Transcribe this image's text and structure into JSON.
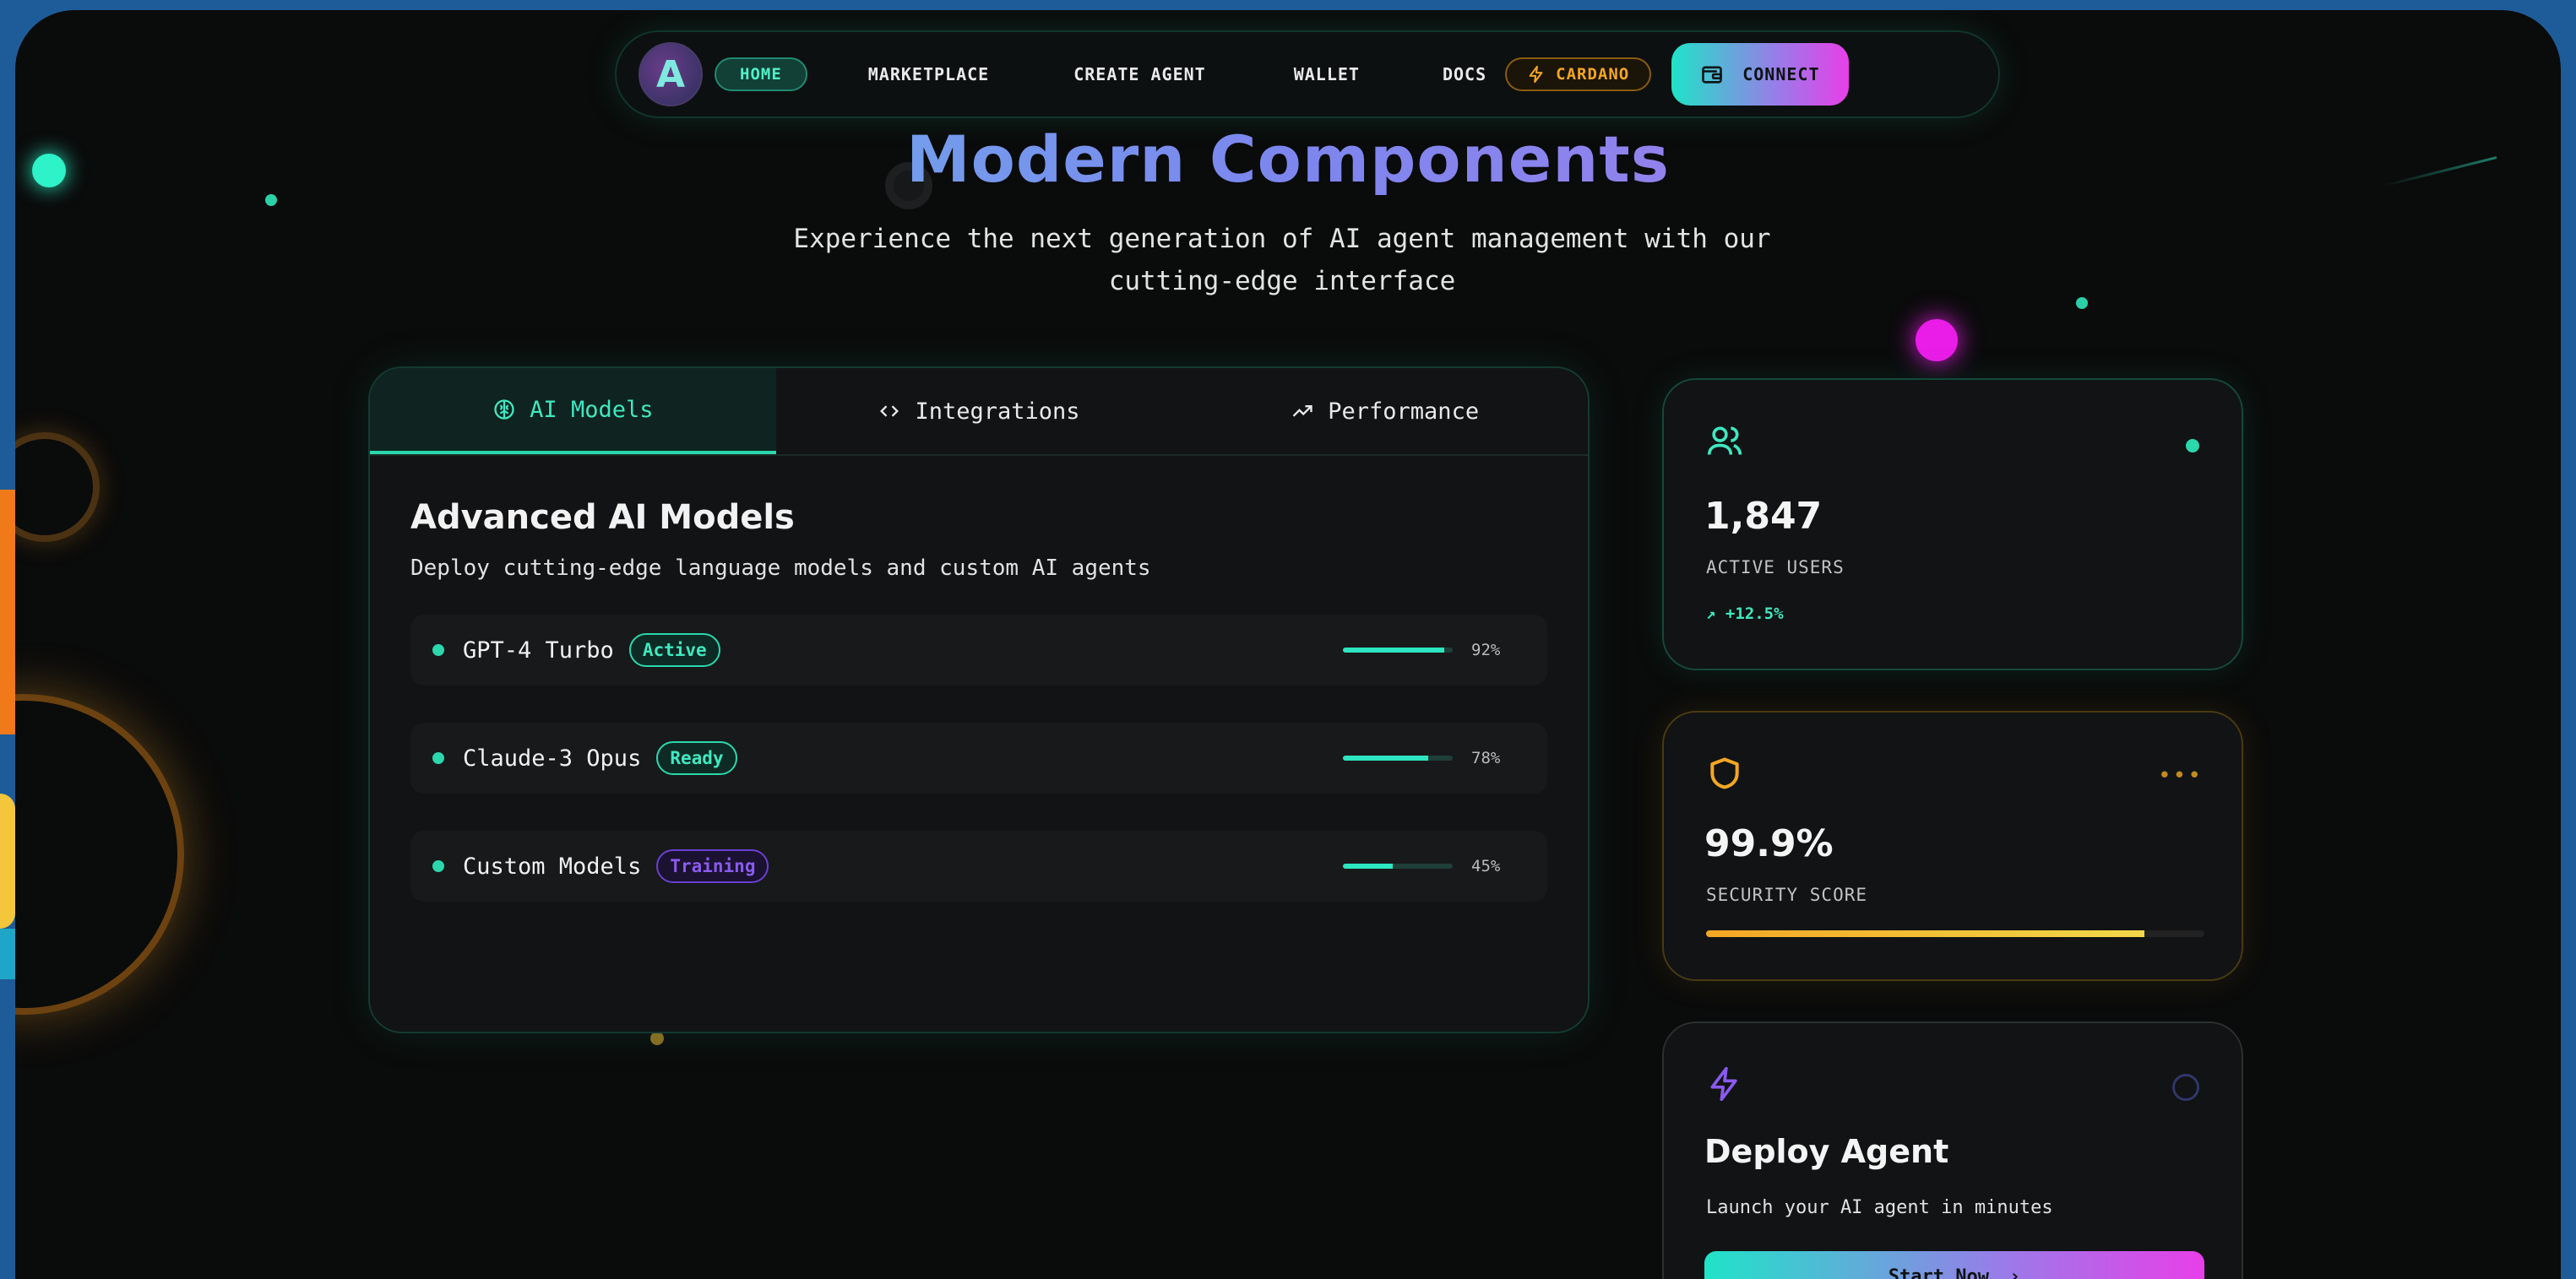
{
  "nav": {
    "logo_letter": "A",
    "home": "HOME",
    "links": [
      "MARKETPLACE",
      "CREATE AGENT",
      "WALLET",
      "DOCS"
    ],
    "cardano": "CARDANO",
    "connect": "CONNECT"
  },
  "hero": {
    "title": "Modern Components",
    "subtitle": "Experience the next generation of AI agent management with our cutting-edge interface"
  },
  "tabs": [
    {
      "label": "AI Models",
      "icon": "brain-icon",
      "active": true
    },
    {
      "label": "Integrations",
      "icon": "code-icon",
      "active": false
    },
    {
      "label": "Performance",
      "icon": "trend-icon",
      "active": false
    }
  ],
  "panel": {
    "title": "Advanced AI Models",
    "description": "Deploy cutting-edge language models and custom AI agents",
    "models": [
      {
        "name": "GPT-4 Turbo",
        "status": "Active",
        "percent_label": "92%",
        "progress": 0.92
      },
      {
        "name": "Claude-3 Opus",
        "status": "Ready",
        "percent_label": "78%",
        "progress": 0.78
      },
      {
        "name": "Custom Models",
        "status": "Training",
        "percent_label": "45%",
        "progress": 0.45
      }
    ]
  },
  "cards": {
    "users": {
      "value": "1,847",
      "label": "ACTIVE USERS",
      "trend": "+12.5%"
    },
    "security": {
      "value": "99.9%",
      "label": "SECURITY SCORE",
      "progress": 0.88
    },
    "deploy": {
      "title": "Deploy Agent",
      "description": "Launch your AI agent in minutes",
      "button": "Start Now"
    }
  },
  "colors": {
    "accent": "#2cd7ad",
    "gold": "#f3a623",
    "purple": "#8a5af0",
    "background": "#0a0b0b",
    "outer": "#1e5c99"
  }
}
